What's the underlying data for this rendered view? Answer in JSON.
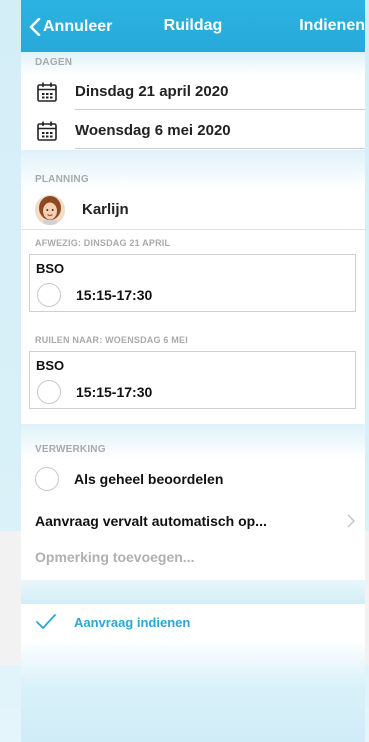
{
  "navbar": {
    "back_label": "Annuleer",
    "title": "Ruildag",
    "submit_label": "Indienen"
  },
  "days": {
    "header": "DAGEN",
    "items": [
      {
        "icon": "calendar-icon",
        "label": "Dinsdag 21 april 2020"
      },
      {
        "icon": "calendar-icon",
        "label": "Woensdag 6 mei 2020"
      }
    ]
  },
  "planning": {
    "header": "PLANNING",
    "person": {
      "name": "Karlijn"
    },
    "absent": {
      "label": "AFWEZIG: DINSDAG 21 APRIL",
      "group": "BSO",
      "time": "15:15-17:30"
    },
    "swap": {
      "label": "RUILEN NAAR: WOENSDAG 6 MEI",
      "group": "BSO",
      "time": "15:15-17:30"
    }
  },
  "processing": {
    "header": "VERWERKING",
    "assess_whole_label": "Als geheel beoordelen",
    "expires_label": "Aanvraag vervalt automatisch op...",
    "comment_placeholder": "Opmerking toevoegen...",
    "comment_value": ""
  },
  "submit": {
    "label": "Aanvraag indienen"
  },
  "colors": {
    "accent": "#2aa7d6",
    "navbar": "#2cb3e0",
    "section_bg": "#dff2f9"
  }
}
